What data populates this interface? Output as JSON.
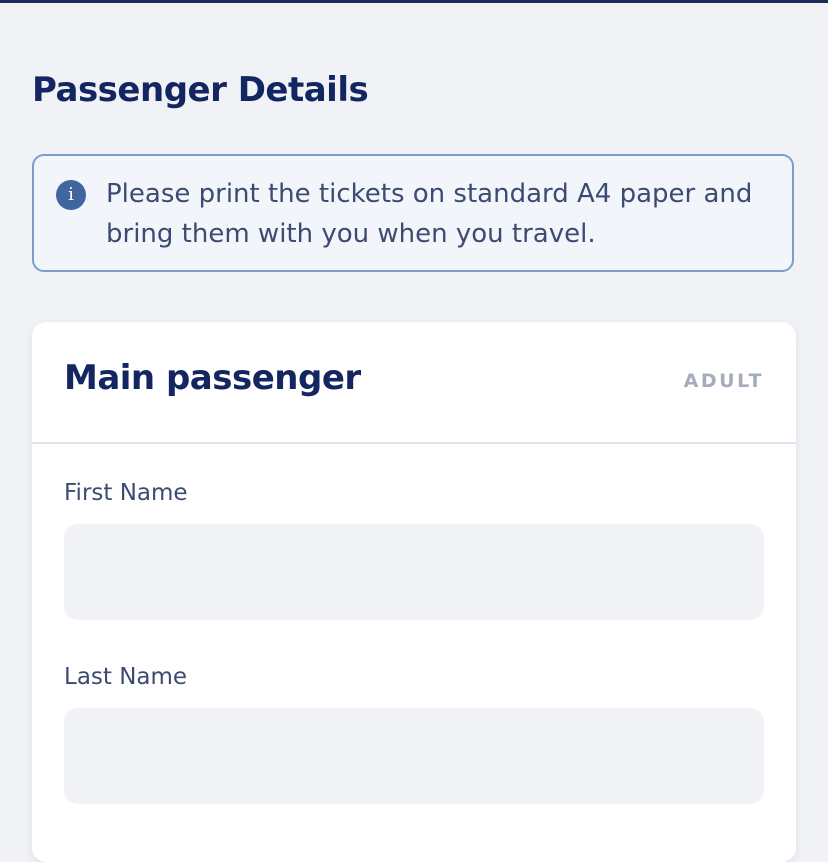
{
  "header": {
    "title": "Passenger Details"
  },
  "notice": {
    "icon": "info-icon",
    "icon_glyph": "i",
    "text": "Please print the tickets on standard A4 paper and bring them with you when you travel."
  },
  "passenger_card": {
    "title": "Main passenger",
    "type": "ADULT",
    "fields": [
      {
        "label": "First Name",
        "value": "",
        "placeholder": ""
      },
      {
        "label": "Last Name",
        "value": "",
        "placeholder": ""
      }
    ]
  },
  "colors": {
    "primary_text": "#142661",
    "accent": "#41659e",
    "info_border": "#7d9cc9",
    "page_background": "#f0f2f6"
  }
}
